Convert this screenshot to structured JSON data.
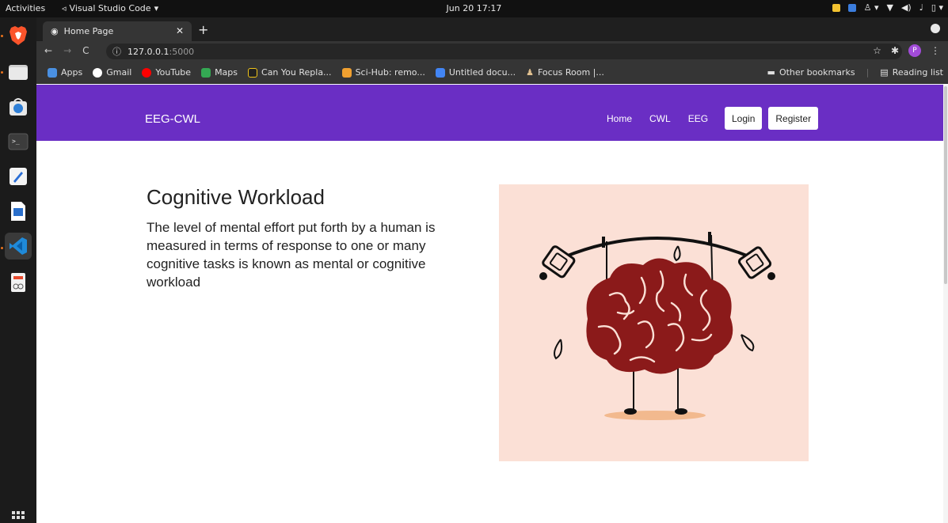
{
  "system_bar": {
    "activities": "Activities",
    "app_name": "Visual Studio Code",
    "clock": "Jun 20  17:17"
  },
  "dock": {
    "apps": [
      {
        "name": "brave-browser-icon",
        "color": "#fb542b"
      },
      {
        "name": "files-icon",
        "color": "#d7d7d7"
      },
      {
        "name": "software-store-icon",
        "color": "#2f7fd6"
      },
      {
        "name": "terminal-icon",
        "color": "#3c3c3c"
      },
      {
        "name": "text-editor-icon",
        "color": "#2b6fd6"
      },
      {
        "name": "writer-icon",
        "color": "#2a6fcb"
      },
      {
        "name": "vscode-icon",
        "color": "#1f8ad9"
      },
      {
        "name": "document-viewer-icon",
        "color": "#e64a2e"
      }
    ]
  },
  "browser": {
    "tab_title": "Home Page",
    "url_host": "127.0.0.1",
    "url_port": ":5000",
    "profile_initial": "P",
    "bookmarks": [
      {
        "label": "Apps",
        "color": "#4a90e2"
      },
      {
        "label": "Gmail",
        "color": "#ffffff"
      },
      {
        "label": "YouTube",
        "color": "#ff0000"
      },
      {
        "label": "Maps",
        "color": "#34a853"
      },
      {
        "label": "Can You Repla...",
        "color": "#f0c419"
      },
      {
        "label": "Sci-Hub: remo...",
        "color": "#f0a030"
      },
      {
        "label": "Untitled docu...",
        "color": "#4285f4"
      },
      {
        "label": "Focus Room |...",
        "color": "#e0c090"
      }
    ],
    "other_bookmarks": "Other bookmarks",
    "reading_list": "Reading list"
  },
  "page": {
    "brand": "EEG-CWL",
    "nav": {
      "home": "Home",
      "cwl": "CWL",
      "eeg": "EEG",
      "login": "Login",
      "register": "Register"
    },
    "hero": {
      "title": "Cognitive Workload",
      "text": "The level of mental effort put forth by a human is measured in terms of response to one or many cognitive tasks is known as mental or cognitive workload"
    }
  },
  "colors": {
    "navbar": "#6a2ec4",
    "illustration_bg": "#fbe0d6",
    "brain": "#8b1a1a"
  }
}
